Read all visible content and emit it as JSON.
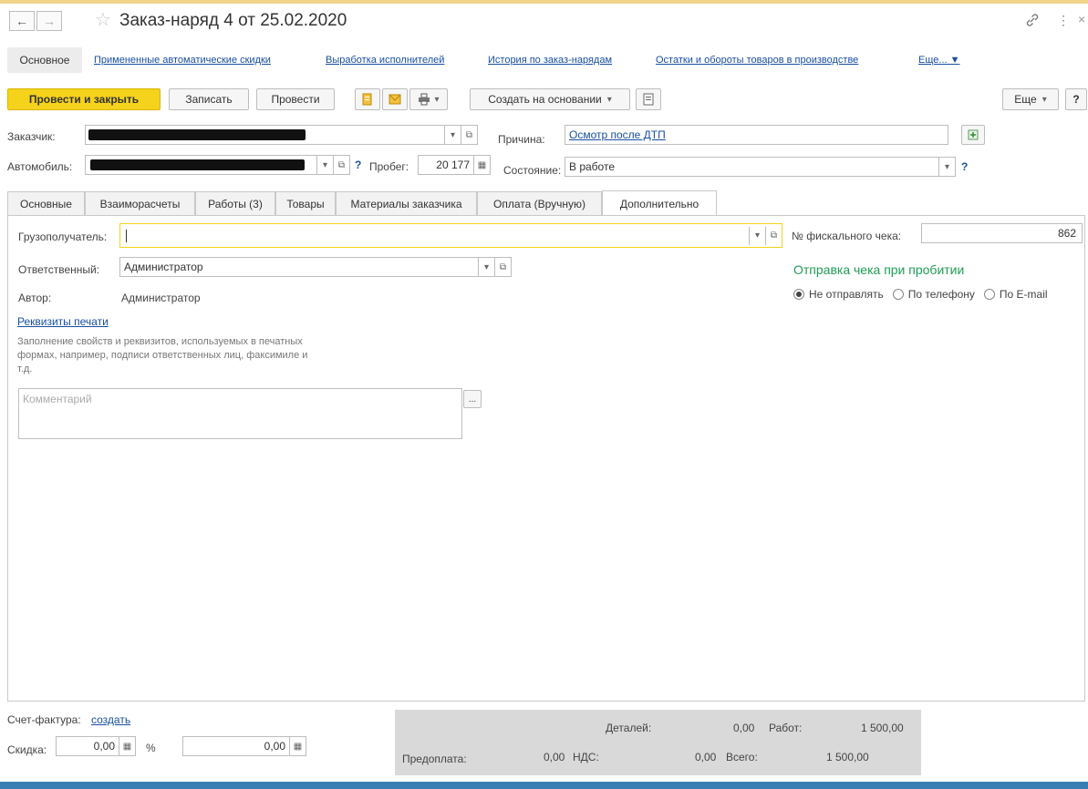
{
  "window": {
    "title": "Заказ-наряд 4 от 25.02.2020",
    "back_icon": "←",
    "forward_icon": "→",
    "star_icon": "☆",
    "link_icon": "🔗",
    "menu_icon": "⋮",
    "close_icon": "×"
  },
  "nav_links": {
    "main": "Основное",
    "items": [
      "Примененные автоматические скидки",
      "Выработка исполнителей",
      "История по заказ-нарядам",
      "Остатки и обороты товаров в производстве",
      "Еще... ▼"
    ]
  },
  "toolbar": {
    "post_close": "Провести и закрыть",
    "save": "Записать",
    "post": "Провести",
    "create_based": "Создать на основании",
    "more": "Еще",
    "help": "?"
  },
  "header_fields": {
    "customer_label": "Заказчик:",
    "reason_label": "Причина:",
    "reason_value": "Осмотр после ДТП",
    "car_label": "Автомобиль:",
    "mileage_label": "Пробег:",
    "mileage_value": "20 177",
    "state_label": "Состояние:",
    "state_value": "В работе",
    "help": "?"
  },
  "tabs": [
    {
      "label": "Основные",
      "active": false
    },
    {
      "label": "Взаиморасчеты",
      "active": false
    },
    {
      "label": "Работы (3)",
      "active": false
    },
    {
      "label": "Товары",
      "active": false
    },
    {
      "label": "Материалы заказчика",
      "active": false
    },
    {
      "label": "Оплата (Вручную)",
      "active": false
    },
    {
      "label": "Дополнительно",
      "active": true
    }
  ],
  "extra": {
    "consignee_label": "Грузополучатель:",
    "consignee_value": "",
    "responsible_label": "Ответственный:",
    "responsible_value": "Администратор",
    "author_label": "Автор:",
    "author_value": "Администратор",
    "print_link": "Реквизиты печати",
    "print_desc_1": "Заполнение свойств и реквизитов, используемых в печатных",
    "print_desc_2": "формах, например, подписи ответственных лиц, факсимиле и",
    "print_desc_3": "т.д.",
    "comment_placeholder": "Комментарий",
    "fiscal_label": "№ фискального чека:",
    "fiscal_value": "862",
    "send_title": "Отправка чека при пробитии",
    "radio": [
      "Не отправлять",
      "По телефону",
      "По E-mail"
    ],
    "radio_selected": "Не отправлять"
  },
  "footer": {
    "invoice_label": "Счет-фактура:",
    "invoice_link": "создать",
    "discount_label": "Скидка:",
    "discount_value": "0,00",
    "percent_sign": "%",
    "discount_sum": "0,00"
  },
  "summary": {
    "parts_label": "Деталей:",
    "parts_value": "0,00",
    "works_label": "Работ:",
    "works_value": "1 500,00",
    "prepay_label": "Предоплата:",
    "prepay_value": "0,00",
    "vat_label": "НДС:",
    "vat_value": "0,00",
    "total_label": "Всего:",
    "total_value": "1 500,00"
  }
}
